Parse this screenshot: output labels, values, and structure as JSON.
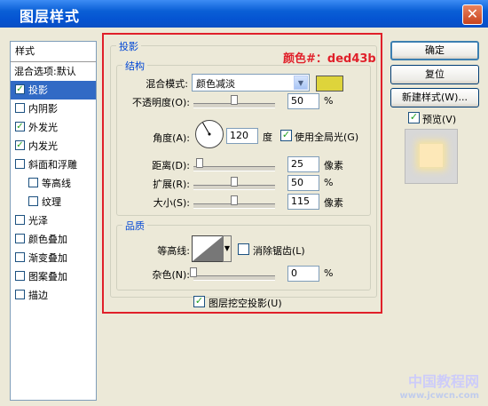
{
  "window": {
    "title": "图层样式",
    "close_glyph": "✕"
  },
  "style_list": {
    "header": "样式",
    "blend_options": "混合选项:默认",
    "items": [
      {
        "label": "投影",
        "checked": true,
        "selected": true
      },
      {
        "label": "内阴影",
        "checked": false
      },
      {
        "label": "外发光",
        "checked": true
      },
      {
        "label": "内发光",
        "checked": true
      },
      {
        "label": "斜面和浮雕",
        "checked": false
      },
      {
        "label": "等高线",
        "checked": false,
        "indent": true
      },
      {
        "label": "纹理",
        "checked": false,
        "indent": true
      },
      {
        "label": "光泽",
        "checked": false
      },
      {
        "label": "颜色叠加",
        "checked": false
      },
      {
        "label": "渐变叠加",
        "checked": false
      },
      {
        "label": "图案叠加",
        "checked": false
      },
      {
        "label": "描边",
        "checked": false
      }
    ],
    "check_glyph": "✓"
  },
  "panel": {
    "title": "投影",
    "structure": {
      "title": "结构",
      "color_note": "颜色#：ded43b",
      "blend_mode_label": "混合模式:",
      "blend_mode_value": "颜色减淡",
      "swatch_color": "#ded43b",
      "opacity_label": "不透明度(O):",
      "opacity_value": "50",
      "opacity_unit": "%",
      "opacity_level": 0.5,
      "angle_label": "角度(A):",
      "angle_value": "120",
      "angle_unit": "度",
      "global_light_label": "使用全局光(G)",
      "global_light_checked": true,
      "distance_label": "距离(D):",
      "distance_value": "25",
      "distance_unit": "像素",
      "distance_level": 0.08,
      "spread_label": "扩展(R):",
      "spread_value": "50",
      "spread_unit": "%",
      "spread_level": 0.5,
      "size_label": "大小(S):",
      "size_value": "115",
      "size_unit": "像素",
      "size_level": 0.5
    },
    "quality": {
      "title": "品质",
      "contour_label": "等高线:",
      "anti_alias_label": "消除锯齿(L)",
      "anti_alias_checked": false,
      "noise_label": "杂色(N):",
      "noise_value": "0",
      "noise_unit": "%",
      "noise_level": 0
    },
    "knockout_label": "图层挖空投影(U)",
    "knockout_checked": true
  },
  "buttons": {
    "ok": "确定",
    "reset": "复位",
    "new_style": "新建样式(W)...",
    "preview_label": "预览(V)",
    "preview_checked": true
  },
  "watermark": {
    "line1": "中国教程网",
    "line2": "www.jcwcn.com"
  }
}
